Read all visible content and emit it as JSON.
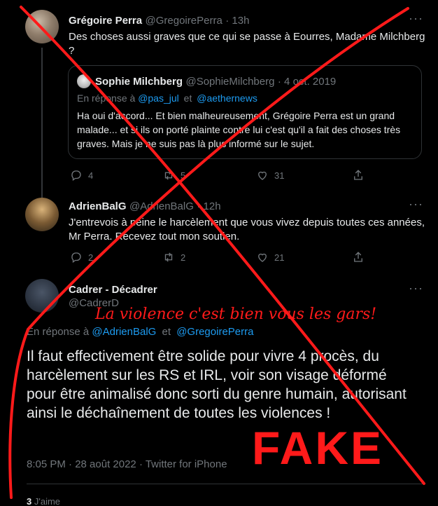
{
  "tweet1": {
    "name": "Grégoire Perra",
    "handle": "@GregoirePerra",
    "time": "· 13h",
    "text_line1": "Des choses aussi graves que ce qui se passe à Eourres, Madame Milchberg",
    "text_line2": "?",
    "quote": {
      "name": "Sophie Milchberg",
      "handle": "@SophieMilchberg",
      "date": "· 4 oct. 2019",
      "reply_prefix": "En réponse à",
      "reply_user1": "@pas_jul",
      "reply_and": "et",
      "reply_user2": "@aethernews",
      "text": "Ha oui d'accord... Et bien malheureusement, Grégoire Perra est un grand malade... et si ils on porté plainte contre lui c'est qu'il a fait des choses très graves. Mais je ne suis pas là plus informé sur le sujet."
    },
    "actions": {
      "replies": "4",
      "retweets": "5",
      "likes": "31"
    }
  },
  "tweet2": {
    "name": "AdrienBalG",
    "handle": "@AdrienBalG",
    "time": "· 12h",
    "text": "J'entrevois à peine le harcèlement que vous vivez depuis toutes ces années, Mr Perra. Recevez tout mon soutien.",
    "actions": {
      "replies": "2",
      "retweets": "2",
      "likes": "21"
    }
  },
  "tweet3": {
    "name": "Cadrer - Décadrer",
    "handle": "@CadrerD",
    "reply_prefix": "En réponse à",
    "reply_user1": "@AdrienBalG",
    "reply_and": "et",
    "reply_user2": "@GregoirePerra",
    "text": "Il faut effectivement être solide pour vivre 4 procès, du harcèlement sur les RS et IRL, voir son visage déformé pour être animalisé donc sorti du genre humain, autorisant ainsi le déchaînement de toutes les violences !",
    "meta": "8:05 PM · 28 août 2022 · Twitter for iPhone",
    "likes_count": "3",
    "likes_label": "J'aime"
  },
  "overlay": {
    "annotation": "La violence c'est bien vous les gars!",
    "stamp": "FAKE",
    "color": "#ff1a1a"
  },
  "icons": [
    "reply-icon",
    "retweet-icon",
    "like-icon",
    "share-icon",
    "more-icon"
  ]
}
